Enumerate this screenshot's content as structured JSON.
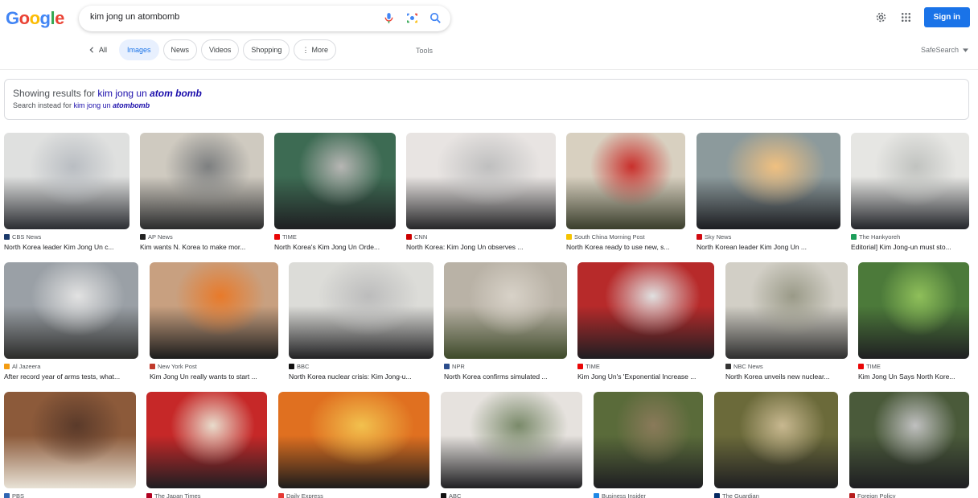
{
  "header": {
    "logo": [
      "G",
      "o",
      "o",
      "g",
      "l",
      "e"
    ],
    "search_value": "kim jong un atombomb",
    "sign_in": "Sign in"
  },
  "tabs": {
    "all": "All",
    "chips": [
      "Images",
      "News",
      "Videos",
      "Shopping",
      "More"
    ],
    "tools": "Tools",
    "safesearch": "SafeSearch"
  },
  "spelling": {
    "showing_prefix": "Showing results for",
    "showing_query_plain": "kim jong un",
    "showing_query_emph": "atom bomb",
    "instead_prefix": "Search instead for",
    "instead_query_plain": "kim jong un",
    "instead_query_emph": "atombomb"
  },
  "results": [
    [
      {
        "source": "CBS News",
        "caption": "North Korea leader Kim Jong Un c...",
        "fav": "#1b3a6b",
        "palette": [
          "#dfe0df",
          "#2b2d32",
          "#b9bdc2"
        ]
      },
      {
        "source": "AP News",
        "caption": "Kim wants N. Korea to make mor...",
        "fav": "#222222",
        "palette": [
          "#cfcac0",
          "#2a2b2c",
          "#7d7f80"
        ]
      },
      {
        "source": "TIME",
        "caption": "North Korea's Kim Jong Un Orde...",
        "fav": "#e90606",
        "palette": [
          "#3d6b53",
          "#1f1f22",
          "#b7b6b4"
        ]
      },
      {
        "source": "CNN",
        "caption": "North Korea: Kim Jong Un observes ...",
        "fav": "#cc0000",
        "palette": [
          "#e8e4e2",
          "#262628",
          "#bfbfbf"
        ]
      },
      {
        "source": "South China Morning Post",
        "caption": "North Korea ready to use new, s...",
        "fav": "#f5c300",
        "palette": [
          "#d8d0c0",
          "#3a3e2c",
          "#c9302c"
        ]
      },
      {
        "source": "Sky News",
        "caption": "North Korean leader Kim Jong Un ...",
        "fav": "#d10a11",
        "palette": [
          "#8c9a9c",
          "#1c1d21",
          "#f0c080"
        ]
      },
      {
        "source": "The Hankyoreh",
        "caption": "Editorial] Kim Jong-un must sto...",
        "fav": "#1d9e5a",
        "palette": [
          "#e6e6e3",
          "#23252a",
          "#c1c3c0"
        ]
      }
    ],
    [
      {
        "source": "Al Jazeera",
        "caption": "After record year of arms tests, what...",
        "fav": "#f39c12",
        "palette": [
          "#9aa0a6",
          "#2c2c2a",
          "#e2e2e2"
        ]
      },
      {
        "source": "New York Post",
        "caption": "Kim Jong Un really wants to start ...",
        "fav": "#c0392b",
        "palette": [
          "#c8a080",
          "#1c1c1c",
          "#e87a2a"
        ]
      },
      {
        "source": "BBC",
        "caption": "North Korea nuclear crisis: Kim Jong-u...",
        "fav": "#111111",
        "palette": [
          "#dcdcd8",
          "#222224",
          "#bcbcbc"
        ]
      },
      {
        "source": "NPR",
        "caption": "North Korea confirms simulated ...",
        "fav": "#2b4d8c",
        "palette": [
          "#b9b2a6",
          "#3e4a2a",
          "#d8d2c8"
        ]
      },
      {
        "source": "TIME",
        "caption": "Kim Jong Un's 'Exponential Increase ...",
        "fav": "#e90606",
        "palette": [
          "#b72a2a",
          "#1e1e22",
          "#e0e0e0"
        ]
      },
      {
        "source": "NBC News",
        "caption": "North Korea unveils new nuclear...",
        "fav": "#333333",
        "palette": [
          "#d2cfc6",
          "#2e2e2e",
          "#9a9a88"
        ]
      },
      {
        "source": "TIME",
        "caption": "Kim Jong Un Says North Kore...",
        "fav": "#e90606",
        "palette": [
          "#4c7a3a",
          "#1f1f22",
          "#8fbf5a"
        ]
      }
    ],
    [
      {
        "source": "PBS",
        "caption": "",
        "fav": "#2f66b3",
        "palette": [
          "#8c5a3a",
          "#e8e2d6",
          "#5a3a2a"
        ]
      },
      {
        "source": "The Japan Times",
        "caption": "",
        "fav": "#b00020",
        "palette": [
          "#c62828",
          "#1e1e22",
          "#e8dccc"
        ]
      },
      {
        "source": "Daily Express",
        "caption": "",
        "fav": "#e53935",
        "palette": [
          "#e07020",
          "#1c1c1c",
          "#f2c14e"
        ]
      },
      {
        "source": "ABC",
        "caption": "",
        "fav": "#111111",
        "palette": [
          "#e6e2de",
          "#1f1f22",
          "#7a8a6a"
        ]
      },
      {
        "source": "Business Insider",
        "caption": "",
        "fav": "#1e88e5",
        "palette": [
          "#5a6b3a",
          "#1e1e22",
          "#8a7a5a"
        ]
      },
      {
        "source": "The Guardian",
        "caption": "",
        "fav": "#052962",
        "palette": [
          "#6b6a3a",
          "#1f1f22",
          "#c8b890"
        ]
      },
      {
        "source": "Foreign Policy",
        "caption": "",
        "fav": "#b71c1c",
        "palette": [
          "#4a5a3a",
          "#1e1e22",
          "#c0c0c0"
        ]
      }
    ]
  ],
  "colors": {
    "accent": "#1a73e8",
    "link": "#1a0dab"
  }
}
